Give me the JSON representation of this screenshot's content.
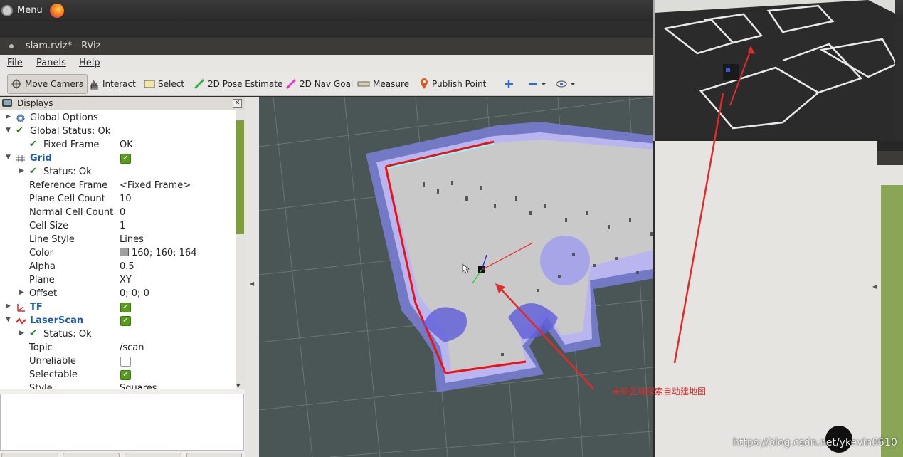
{
  "desktop": {
    "menu_label": "Menu"
  },
  "window": {
    "title": "slam.rviz* - RViz"
  },
  "menubar": {
    "items": [
      "File",
      "Panels",
      "Help"
    ]
  },
  "toolbar": {
    "move_camera": "Move Camera",
    "interact": "Interact",
    "select": "Select",
    "pose_estimate": "2D Pose Estimate",
    "nav_goal": "2D Nav Goal",
    "measure": "Measure",
    "publish_point": "Publish Point"
  },
  "displays": {
    "title": "Displays",
    "rows": [
      {
        "name": "Global Options",
        "value": ""
      },
      {
        "name": "Global Status: Ok",
        "value": ""
      },
      {
        "name": "Fixed Frame",
        "value": "OK"
      },
      {
        "name": "Grid",
        "value": ""
      },
      {
        "name": "Status: Ok",
        "value": ""
      },
      {
        "name": "Reference Frame",
        "value": "<Fixed Frame>"
      },
      {
        "name": "Plane Cell Count",
        "value": "10"
      },
      {
        "name": "Normal Cell Count",
        "value": "0"
      },
      {
        "name": "Cell Size",
        "value": "1"
      },
      {
        "name": "Line Style",
        "value": "Lines"
      },
      {
        "name": "Color",
        "value": "160; 160; 164"
      },
      {
        "name": "Alpha",
        "value": "0.5"
      },
      {
        "name": "Plane",
        "value": "XY"
      },
      {
        "name": "Offset",
        "value": "0; 0; 0"
      },
      {
        "name": "TF",
        "value": ""
      },
      {
        "name": "LaserScan",
        "value": ""
      },
      {
        "name": "Status: Ok",
        "value": ""
      },
      {
        "name": "Topic",
        "value": "/scan"
      },
      {
        "name": "Unreliable",
        "value": ""
      },
      {
        "name": "Selectable",
        "value": ""
      },
      {
        "name": "Style",
        "value": "Squares"
      }
    ]
  },
  "annotation": "未知区域探索自动建地图",
  "watermark": "https://blog.csdn.net/ykevin0510",
  "colors": {
    "accent_red": "#e02b2b",
    "check_green": "#5a9a1f",
    "grid_color": "#a0a0a4"
  }
}
